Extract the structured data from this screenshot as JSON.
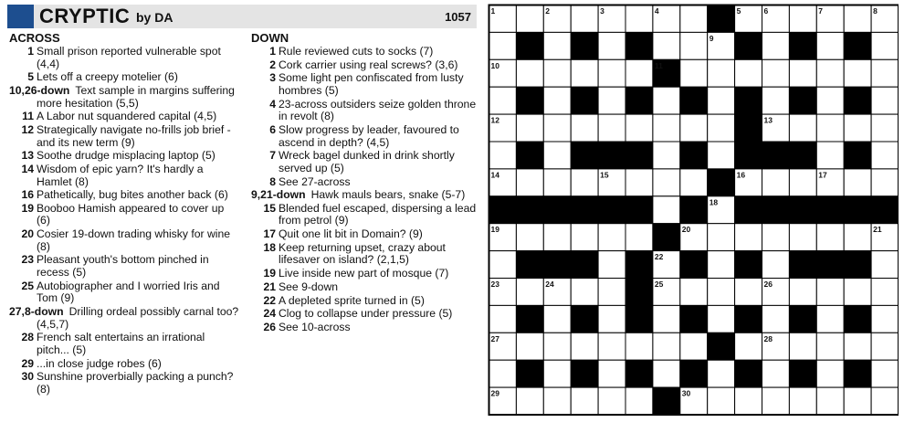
{
  "header": {
    "title": "CRYPTIC",
    "byline": "by DA",
    "number": "1057",
    "accent_color": "#1d4e8f"
  },
  "across": {
    "heading": "ACROSS",
    "clues": [
      {
        "num": "1",
        "text": "Small prison reported vulnerable spot (4,4)"
      },
      {
        "num": "5",
        "text": "Lets off a creepy motelier (6)"
      },
      {
        "num": "10,26-down",
        "text": "Text sample in margins suffering more hesitation (5,5)"
      },
      {
        "num": "11",
        "text": "A Labor nut squandered capital (4,5)"
      },
      {
        "num": "12",
        "text": "Strategically navigate no-frills job brief - and its new term (9)"
      },
      {
        "num": "13",
        "text": "Soothe drudge misplacing laptop (5)"
      },
      {
        "num": "14",
        "text": "Wisdom of epic yarn? It's hardly a Hamlet (8)"
      },
      {
        "num": "16",
        "text": "Pathetically, bug bites another back (6)"
      },
      {
        "num": "19",
        "text": "Booboo Hamish appeared to cover up (6)"
      },
      {
        "num": "20",
        "text": "Cosier 19-down trading whisky for wine (8)"
      },
      {
        "num": "23",
        "text": "Pleasant youth's bottom pinched in recess (5)"
      },
      {
        "num": "25",
        "text": "Autobiographer and I worried Iris and Tom (9)"
      },
      {
        "num": "27,8-down",
        "text": "Drilling ordeal possibly carnal too? (4,5,7)"
      },
      {
        "num": "28",
        "text": "French salt entertains an irrational pitch... (5)"
      },
      {
        "num": "29",
        "text": "...in close judge robes (6)"
      },
      {
        "num": "30",
        "text": "Sunshine proverbially packing a punch? (8)"
      }
    ]
  },
  "down": {
    "heading": "DOWN",
    "clues": [
      {
        "num": "1",
        "text": "Rule reviewed cuts to socks (7)"
      },
      {
        "num": "2",
        "text": "Cork carrier using real screws? (3,6)"
      },
      {
        "num": "3",
        "text": "Some light pen confiscated from lusty hombres (5)"
      },
      {
        "num": "4",
        "text": "23-across outsiders seize golden throne in revolt (8)"
      },
      {
        "num": "6",
        "text": "Slow progress by leader, favoured to ascend in depth? (4,5)"
      },
      {
        "num": "7",
        "text": "Wreck bagel dunked in drink shortly served up (5)"
      },
      {
        "num": "8",
        "text": "See 27-across"
      },
      {
        "num": "9,21-down",
        "text": "Hawk mauls bears, snake (5-7)"
      },
      {
        "num": "15",
        "text": "Blended fuel escaped, dispersing a lead from petrol (9)"
      },
      {
        "num": "17",
        "text": "Quit one lit bit in Domain? (9)"
      },
      {
        "num": "18",
        "text": "Keep returning upset, crazy about lifesaver on island? (2,1,5)"
      },
      {
        "num": "19",
        "text": "Live inside new part of mosque (7)"
      },
      {
        "num": "21",
        "text": "See 9-down"
      },
      {
        "num": "22",
        "text": "A depleted sprite turned in (5)"
      },
      {
        "num": "24",
        "text": "Clog to collapse under pressure (5)"
      },
      {
        "num": "26",
        "text": "See 10-across"
      }
    ]
  },
  "grid": {
    "rows": [
      "........#......",
      ".#.#.#...#.#.#.",
      "......#........",
      ".#.#.#.#.#.#.#.",
      ".........#.....",
      ".#.###.#.###.#.",
      "........#......",
      "######.#.######",
      "......#........",
      ".###.#.#.#.###.",
      ".....#.........",
      ".#.#.#.#.#.#.#.",
      "........#......",
      ".#.#.#.#.#.#.#.",
      "......#........"
    ],
    "numbers": [
      {
        "r": 0,
        "c": 0,
        "n": "1"
      },
      {
        "r": 0,
        "c": 2,
        "n": "2"
      },
      {
        "r": 0,
        "c": 4,
        "n": "3"
      },
      {
        "r": 0,
        "c": 6,
        "n": "4"
      },
      {
        "r": 0,
        "c": 9,
        "n": "5"
      },
      {
        "r": 0,
        "c": 10,
        "n": "6"
      },
      {
        "r": 0,
        "c": 12,
        "n": "7"
      },
      {
        "r": 0,
        "c": 14,
        "n": "8"
      },
      {
        "r": 1,
        "c": 8,
        "n": "9"
      },
      {
        "r": 2,
        "c": 0,
        "n": "10"
      },
      {
        "r": 2,
        "c": 6,
        "n": "11"
      },
      {
        "r": 4,
        "c": 0,
        "n": "12"
      },
      {
        "r": 4,
        "c": 10,
        "n": "13"
      },
      {
        "r": 6,
        "c": 0,
        "n": "14"
      },
      {
        "r": 6,
        "c": 4,
        "n": "15"
      },
      {
        "r": 6,
        "c": 9,
        "n": "16"
      },
      {
        "r": 6,
        "c": 12,
        "n": "17"
      },
      {
        "r": 7,
        "c": 8,
        "n": "18"
      },
      {
        "r": 8,
        "c": 0,
        "n": "19"
      },
      {
        "r": 8,
        "c": 7,
        "n": "20"
      },
      {
        "r": 8,
        "c": 14,
        "n": "21"
      },
      {
        "r": 9,
        "c": 6,
        "n": "22"
      },
      {
        "r": 10,
        "c": 0,
        "n": "23"
      },
      {
        "r": 10,
        "c": 2,
        "n": "24"
      },
      {
        "r": 10,
        "c": 6,
        "n": "25"
      },
      {
        "r": 10,
        "c": 10,
        "n": "26"
      },
      {
        "r": 12,
        "c": 0,
        "n": "27"
      },
      {
        "r": 12,
        "c": 10,
        "n": "28"
      },
      {
        "r": 14,
        "c": 0,
        "n": "29"
      },
      {
        "r": 14,
        "c": 7,
        "n": "30"
      }
    ]
  }
}
